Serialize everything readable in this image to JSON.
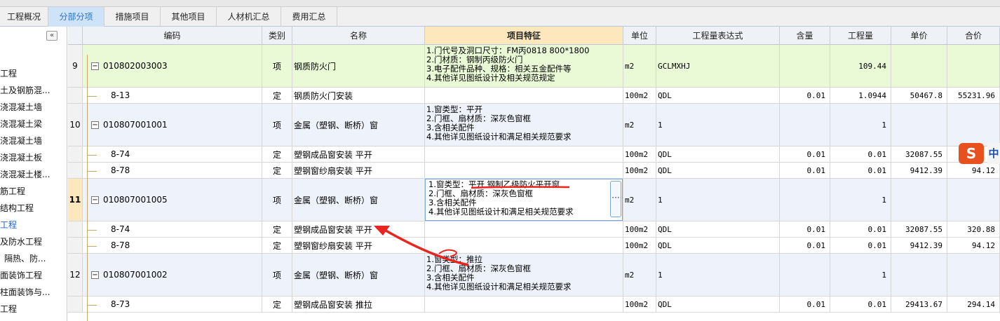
{
  "tabs": [
    "工程概况",
    "分部分项",
    "措施项目",
    "其他项目",
    "人材机汇总",
    "费用汇总"
  ],
  "active_tab": 1,
  "sidebar": {
    "collapse_label": "«",
    "items": [
      "工程",
      "土及钢筋混...",
      "浇混凝土墙",
      "浇混凝土梁",
      "浇混凝土墙",
      "浇混凝土板",
      "浇混凝土楼...",
      "筋工程",
      "结构工程",
      "工程",
      "及防水工程",
      "隔热、防...",
      "面装饰工程",
      "柱面装饰与...",
      "工程"
    ],
    "selected_index": 9
  },
  "columns": [
    "编码",
    "类别",
    "名称",
    "项目特征",
    "单位",
    "工程量表达式",
    "含量",
    "工程量",
    "单价",
    "合价"
  ],
  "rows": [
    {
      "num": "9",
      "code": "010802003003",
      "type": "项",
      "name": "钢质防火门",
      "features": [
        "1.门代号及洞口尺寸：FM丙0818  800*1800",
        "2.门材质：钢制丙级防火门",
        "3.电子配件品种、规格：相关五金配件等",
        "4.其他详见图纸设计及相关规范规定"
      ],
      "unit": "m2",
      "expr": "GCLMXHJ",
      "content": "",
      "qty": "109.44",
      "price": "",
      "total": ""
    },
    {
      "num": "",
      "code": "8-13",
      "type": "定",
      "name": "钢质防火门安装",
      "features": [],
      "unit": "100m2",
      "expr": "QDL",
      "content": "0.01",
      "qty": "1.0944",
      "price": "50467.8",
      "total": "55231.96"
    },
    {
      "num": "10",
      "code": "010807001001",
      "type": "项",
      "name": "金属（塑钢、断桥）窗",
      "features": [
        "1.窗类型：平开",
        "2.门框、扇材质：深灰色窗框",
        "3.含相关配件",
        "4.其他详见图纸设计和满足相关规范要求"
      ],
      "unit": "m2",
      "expr": "1",
      "content": "",
      "qty": "1",
      "price": "",
      "total": ""
    },
    {
      "num": "",
      "code": "8-74",
      "type": "定",
      "name": "塑钢成品窗安装 平开",
      "features": [],
      "unit": "100m2",
      "expr": "QDL",
      "content": "0.01",
      "qty": "0.01",
      "price": "32087.55",
      "total": ""
    },
    {
      "num": "",
      "code": "8-78",
      "type": "定",
      "name": "塑钢窗纱扇安装 平开",
      "features": [],
      "unit": "100m2",
      "expr": "QDL",
      "content": "0.01",
      "qty": "0.01",
      "price": "9412.39",
      "total": "94.12"
    },
    {
      "num": "11",
      "code": "010807001005",
      "type": "项",
      "name": "金属（塑钢、断桥）窗",
      "features": [
        "1.窗类型：平开 钢制乙级防火平开窗",
        "2.门框、扇材质：深灰色窗框",
        "3.含相关配件",
        "4.其他详见图纸设计和满足相关规范要求"
      ],
      "unit": "m2",
      "expr": "1",
      "content": "",
      "qty": "1",
      "price": "",
      "total": ""
    },
    {
      "num": "",
      "code": "8-74",
      "type": "定",
      "name": "塑钢成品窗安装 平开",
      "features": [],
      "unit": "100m2",
      "expr": "QDL",
      "content": "0.01",
      "qty": "0.01",
      "price": "32087.55",
      "total": "320.88"
    },
    {
      "num": "",
      "code": "8-78",
      "type": "定",
      "name": "塑钢窗纱扇安装 平开",
      "features": [],
      "unit": "100m2",
      "expr": "QDL",
      "content": "0.01",
      "qty": "0.01",
      "price": "9412.39",
      "total": "94.12"
    },
    {
      "num": "12",
      "code": "010807001002",
      "type": "项",
      "name": "金属（塑钢、断桥）窗",
      "features": [
        "1.窗类型：推拉",
        "2.门框、扇材质：深灰色窗框",
        "3.含相关配件",
        "4.其他详见图纸设计和满足相关规范要求"
      ],
      "unit": "m2",
      "expr": "1",
      "content": "",
      "qty": "1",
      "price": "",
      "total": ""
    },
    {
      "num": "",
      "code": "8-73",
      "type": "定",
      "name": "塑钢成品窗安装 推拉",
      "features": [],
      "unit": "100m2",
      "expr": "QDL",
      "content": "0.01",
      "qty": "0.01",
      "price": "29413.67",
      "total": "294.14"
    }
  ],
  "selected_row_num": "11",
  "ellipsis_label": "···",
  "ime_badge": "S",
  "ime_lang": "中",
  "colors": {
    "accent": "#2a72c8",
    "header_highlight": "#fde8bd",
    "green_row": "#eafad6",
    "blue_row": "#eef3fb",
    "annotation": "#e8251e"
  }
}
